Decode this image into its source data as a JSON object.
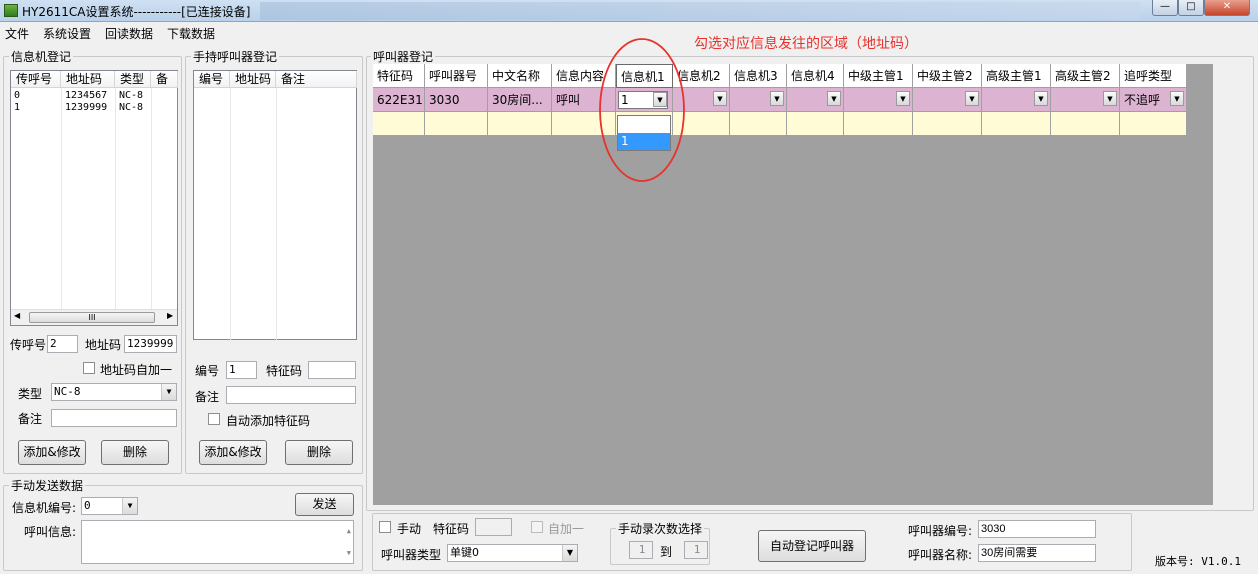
{
  "window": {
    "title": "HY2611CA设置系统-----------[已连接设备]"
  },
  "menu": [
    "文件",
    "系统设置",
    "回读数据",
    "下载数据"
  ],
  "info_panel": {
    "title": "信息机登记",
    "columns": [
      "传呼号",
      "地址码",
      "类型",
      "备注"
    ],
    "rows": [
      {
        "paging": "0",
        "address": "1234567",
        "type": "NC-8",
        "note": ""
      },
      {
        "paging": "1",
        "address": "1239999",
        "type": "NC-8",
        "note": ""
      }
    ],
    "paging_label": "传呼号",
    "paging_value": "2",
    "address_label": "地址码",
    "address_value": "1239999",
    "auto_inc_label": "地址码自加一",
    "type_label": "类型",
    "type_value": "NC-8",
    "note_label": "备注",
    "note_value": "",
    "add_btn": "添加&修改",
    "del_btn": "删除",
    "scroll_mid": "III"
  },
  "handheld_panel": {
    "title": "手持呼叫器登记",
    "columns": [
      "编号",
      "地址码",
      "备注"
    ],
    "num_label": "编号",
    "num_value": "1",
    "code_label": "特征码",
    "code_value": "",
    "note_label": "备注",
    "note_value": "",
    "auto_add_label": "自动添加特征码",
    "add_btn": "添加&修改",
    "del_btn": "删除"
  },
  "manual_panel": {
    "title": "手动发送数据",
    "info_num_label": "信息机编号:",
    "info_num_value": "0",
    "send_btn": "发送",
    "msg_label": "呼叫信息:"
  },
  "caller_panel": {
    "title": "呼叫器登记",
    "columns": [
      "特征码",
      "呼叫器号",
      "中文名称",
      "信息内容",
      "信息机1",
      "信息机2",
      "信息机3",
      "信息机4",
      "中级主管1",
      "中级主管2",
      "高级主管1",
      "高级主管2",
      "追呼类型"
    ],
    "row": {
      "code": "622E31",
      "number": "3030",
      "name": "30房间...",
      "content": "呼叫",
      "info1": "1",
      "chase": "不追呼"
    },
    "dropdown_options": [
      "",
      "1"
    ],
    "annotation": "勾选对应信息发往的区域（地址码）"
  },
  "bottom": {
    "manual_label": "手动",
    "code_label": "特征码",
    "code_value": "",
    "auto_inc_label": "自加一",
    "times_title": "手动录次数选择",
    "times_from": "1",
    "to_label": "到",
    "times_to": "1",
    "auto_register_btn": "自动登记呼叫器",
    "caller_type_label": "呼叫器类型",
    "caller_type_value": "单键0",
    "caller_num_label": "呼叫器编号:",
    "caller_num_value": "3030",
    "caller_name_label": "呼叫器名称:",
    "caller_name_value": "30房间需要",
    "version": "版本号: V1.0.1"
  },
  "colors": {
    "row_pink": "#dcb4d2",
    "row_yellow": "#fffbd6",
    "grid_bg": "#a0a0a0",
    "select": "#3399ff",
    "annotation": "#e8322c"
  }
}
